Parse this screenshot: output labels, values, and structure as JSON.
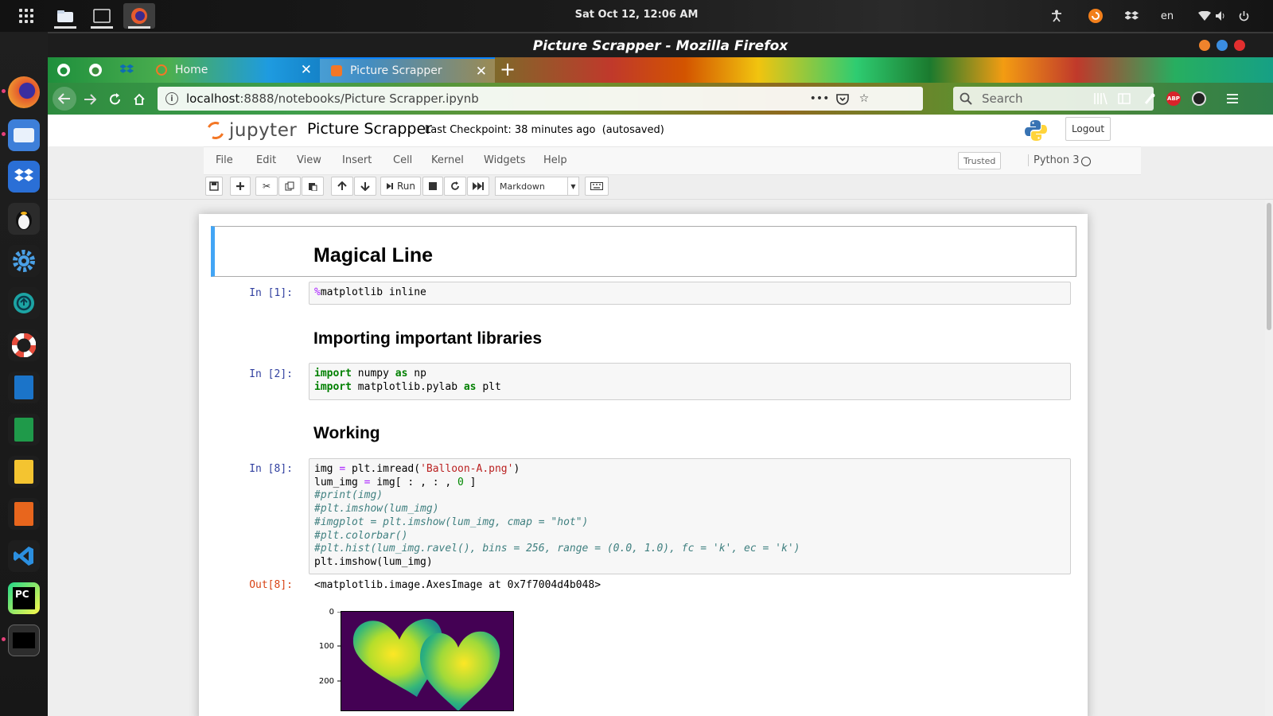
{
  "desktop": {
    "clock": "Sat Oct 12, 12:06 AM",
    "lang": "en"
  },
  "window": {
    "title": "Picture Scrapper - Mozilla Firefox"
  },
  "browser": {
    "tabs": [
      {
        "label": "Home"
      },
      {
        "label": "Picture Scrapper"
      }
    ],
    "url_host": "localhost",
    "url_rest": ":8888/notebooks/Picture Scrapper.ipynb",
    "search_placeholder": "Search",
    "abp": "ABP"
  },
  "jupyter": {
    "logo_text": "jupyter",
    "notebook_name": "Picture Scrapper",
    "checkpoint": "Last Checkpoint: 38 minutes ago",
    "autosave": "(autosaved)",
    "logout": "Logout",
    "menu": [
      "File",
      "Edit",
      "View",
      "Insert",
      "Cell",
      "Kernel",
      "Widgets",
      "Help"
    ],
    "trusted": "Trusted",
    "kernel_name": "Python 3",
    "run_label": "Run",
    "cell_type": "Markdown"
  },
  "notebook": {
    "h1": "Magical Line",
    "h2_import": "Importing important libraries",
    "h2_working": "Working",
    "prompt1": "In [1]:",
    "prompt2": "In [2]:",
    "prompt8": "In [8]:",
    "out8": "Out[8]:",
    "output_text": "<matplotlib.image.AxesImage at 0x7f7004d4b048>",
    "plot_yticks": [
      "0",
      "100",
      "200"
    ]
  }
}
